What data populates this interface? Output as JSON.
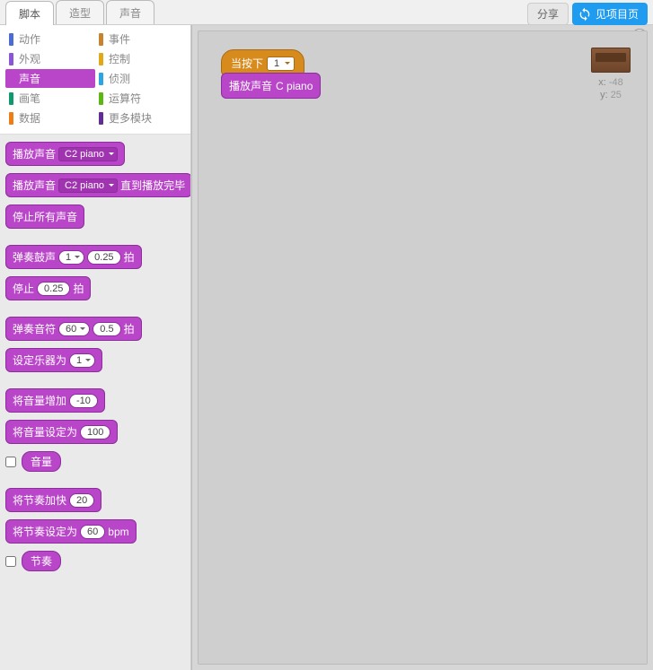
{
  "tabs": {
    "scripts": "脚本",
    "costumes": "造型",
    "sounds": "声音"
  },
  "topbar": {
    "share": "分享",
    "project_page": "见项目页"
  },
  "categories": {
    "motion": {
      "label": "动作",
      "color": "#4a6cd4"
    },
    "looks": {
      "label": "外观",
      "color": "#8a55d7"
    },
    "sound": {
      "label": "声音",
      "color": "#b945c9"
    },
    "pen": {
      "label": "画笔",
      "color": "#0e9a6c"
    },
    "data": {
      "label": "数据",
      "color": "#ee7d16"
    },
    "events": {
      "label": "事件",
      "color": "#c88330"
    },
    "control": {
      "label": "控制",
      "color": "#e1a91a"
    },
    "sensing": {
      "label": "侦测",
      "color": "#2ca5e2"
    },
    "operators": {
      "label": "运算符",
      "color": "#5cb712"
    },
    "more": {
      "label": "更多模块",
      "color": "#632d99"
    }
  },
  "palette": {
    "play_sound": "播放声音",
    "play_sound_opt": "C2 piano",
    "play_until": "播放声音",
    "play_until_opt": "C2 piano",
    "play_until_suffix": "直到播放完毕",
    "stop_all": "停止所有声音",
    "play_drum": "弹奏鼓声",
    "play_drum_v1": "1",
    "play_drum_v2": "0.25",
    "play_drum_suffix": "拍",
    "rest": "停止",
    "rest_v": "0.25",
    "rest_suffix": "拍",
    "play_note": "弹奏音符",
    "play_note_v1": "60",
    "play_note_v2": "0.5",
    "play_note_suffix": "拍",
    "set_instrument": "设定乐器为",
    "set_instrument_v": "1",
    "change_volume": "将音量增加",
    "change_volume_v": "-10",
    "set_volume": "将音量设定为",
    "set_volume_v": "100",
    "volume_reporter": "音量",
    "change_tempo": "将节奏加快",
    "change_tempo_v": "20",
    "set_tempo": "将节奏设定为",
    "set_tempo_v": "60",
    "set_tempo_suffix": "bpm",
    "tempo_reporter": "节奏"
  },
  "script": {
    "hat_label": "当按下",
    "hat_key": "1",
    "play_label": "播放声音",
    "play_opt": "C piano"
  },
  "sprite": {
    "x_label": "x:",
    "x_val": "-48",
    "y_label": "y:",
    "y_val": "25"
  },
  "help": "?"
}
